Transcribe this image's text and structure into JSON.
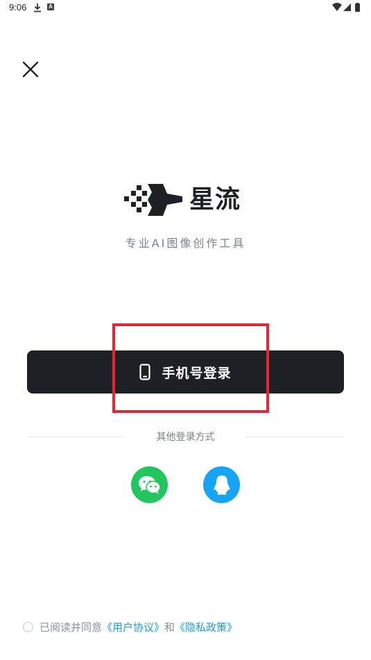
{
  "status_bar": {
    "time": "9:06",
    "icons": [
      "download-icon",
      "a-notification-icon",
      "wifi-icon",
      "signal-icon",
      "battery-icon"
    ]
  },
  "close": {
    "icon": "close-icon"
  },
  "brand": {
    "name": "星流",
    "tagline": "专业AI图像创作工具",
    "color": "#1e2026"
  },
  "login": {
    "phone_label": "手机号登录",
    "phone_icon": "phone-icon",
    "button_color": "#1e2026",
    "other_methods_label": "其他登录方式",
    "wechat": {
      "icon": "wechat-icon",
      "color": "#22c55e"
    },
    "qq": {
      "icon": "qq-icon",
      "color": "#16a5f5"
    }
  },
  "agreement": {
    "prefix": "已阅读并同意",
    "user_agreement": "《用户协议》",
    "and": "和",
    "privacy_policy": "《隐私政策》",
    "checked": false,
    "link_color": "#1a9de3"
  },
  "annotation": {
    "highlight_color": "#e32636"
  }
}
